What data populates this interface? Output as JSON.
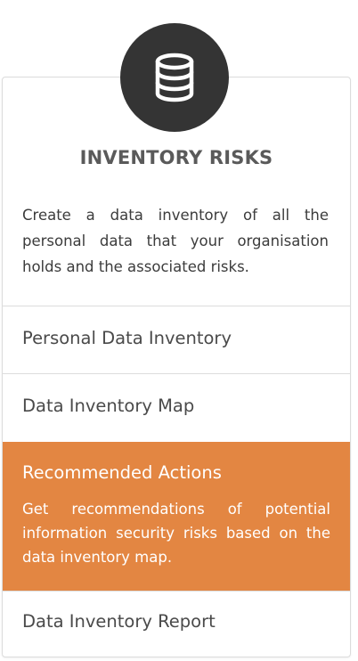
{
  "card": {
    "icon": "database-icon",
    "title": "INVENTORY RISKS",
    "description": "Create a data inventory of all the personal data that your organisation holds and the associated risks."
  },
  "menu": {
    "items": [
      {
        "label": "Personal Data Inventory"
      },
      {
        "label": "Data Inventory Map"
      },
      {
        "label": "Recommended Actions",
        "description": "Get recommendations of potential information security risks based on the data inventory map."
      },
      {
        "label": "Data Inventory Report"
      }
    ],
    "active_index": 2
  },
  "colors": {
    "icon_bg": "#343434",
    "active_bg": "#e38642",
    "border": "#dcdcdc",
    "title": "#5a5a5a"
  }
}
